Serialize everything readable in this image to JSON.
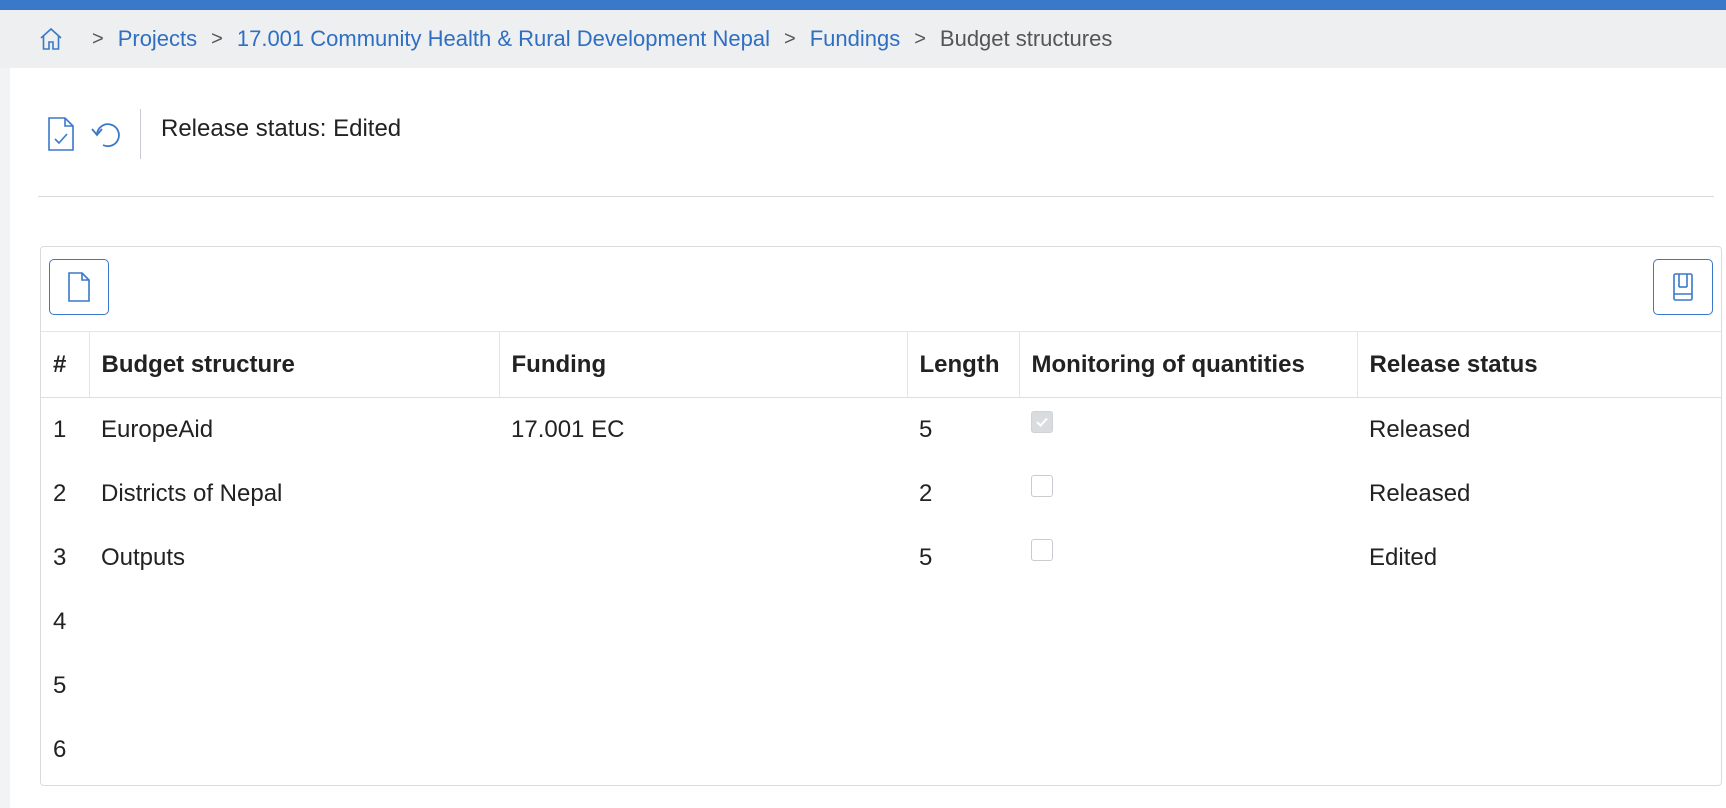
{
  "breadcrumb": {
    "items": [
      "Projects",
      "17.001 Community Health & Rural Development Nepal",
      "Fundings"
    ],
    "current": "Budget structures"
  },
  "toolbar": {
    "release_status": "Release status: Edited"
  },
  "table": {
    "columns": [
      "#",
      "Budget structure",
      "Funding",
      "Length",
      "Monitoring of quantities",
      "Release status"
    ],
    "rows": [
      {
        "num": "1",
        "budget_structure": "EuropeAid",
        "funding": "17.001 EC",
        "length": "5",
        "monitoring": true,
        "release_status": "Released"
      },
      {
        "num": "2",
        "budget_structure": "Districts of Nepal",
        "funding": "",
        "length": "2",
        "monitoring": false,
        "release_status": "Released"
      },
      {
        "num": "3",
        "budget_structure": "Outputs",
        "funding": "",
        "length": "5",
        "monitoring": false,
        "release_status": "Edited"
      },
      {
        "num": "4",
        "budget_structure": "",
        "funding": "",
        "length": "",
        "monitoring": null,
        "release_status": ""
      },
      {
        "num": "5",
        "budget_structure": "",
        "funding": "",
        "length": "",
        "monitoring": null,
        "release_status": ""
      },
      {
        "num": "6",
        "budget_structure": "",
        "funding": "",
        "length": "",
        "monitoring": null,
        "release_status": ""
      }
    ]
  },
  "colors": {
    "accent": "#3a78c9",
    "link": "#2f6fc2"
  }
}
